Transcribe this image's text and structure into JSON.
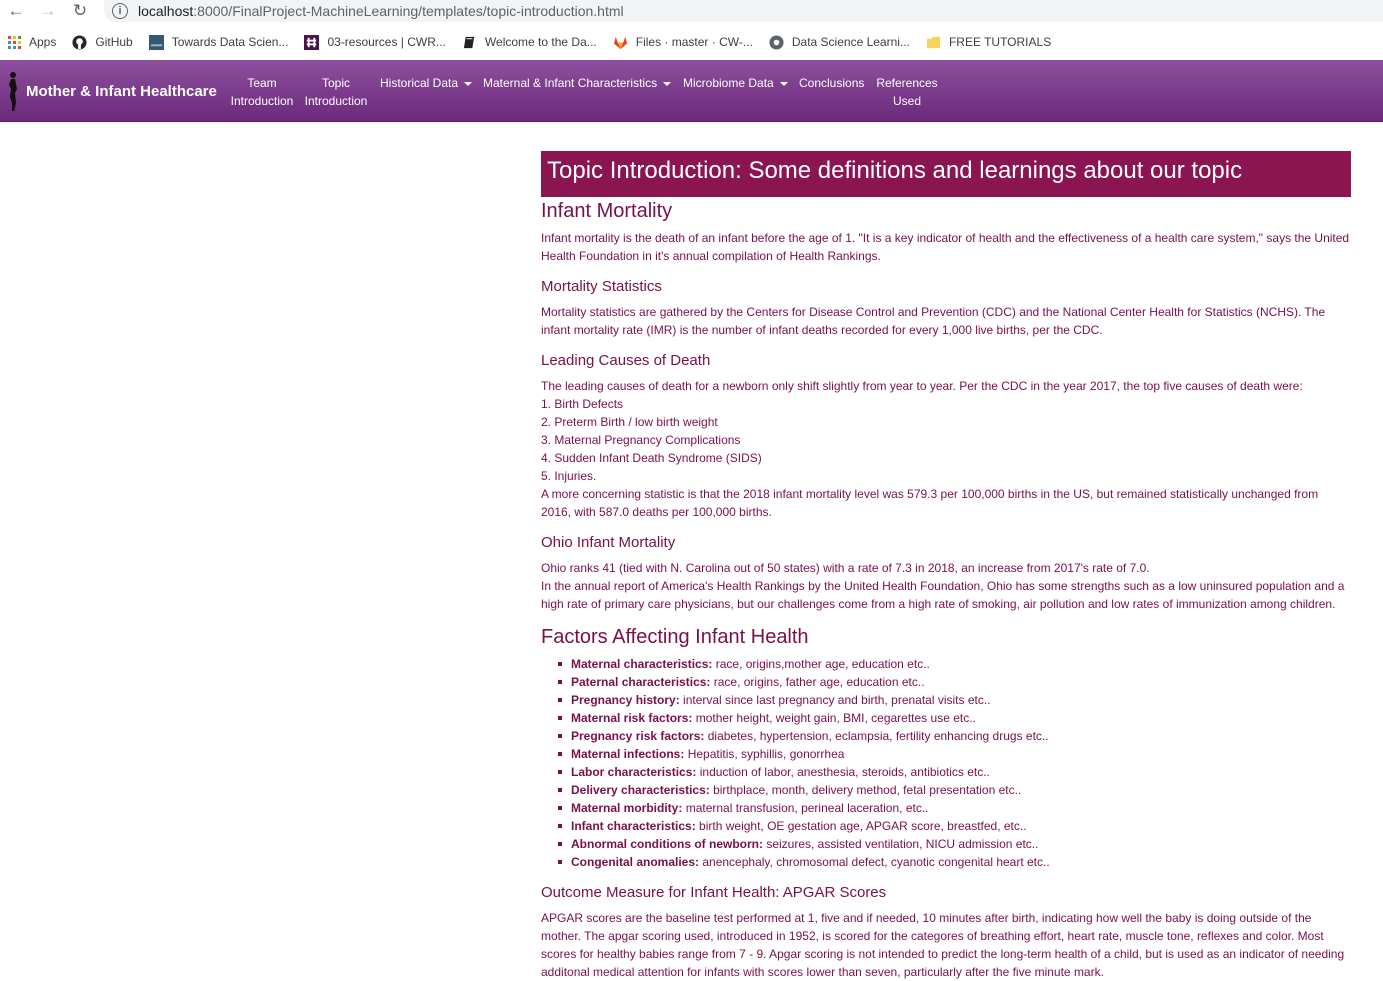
{
  "browser": {
    "url_host": "localhost",
    "url_path": ":8000/FinalProject-MachineLearning/templates/topic-introduction.html"
  },
  "bookmarks": [
    {
      "label": "Apps",
      "icon": "apps-grid-icon"
    },
    {
      "label": "GitHub",
      "icon": "github-icon"
    },
    {
      "label": "Towards Data Scien...",
      "icon": "tds-icon"
    },
    {
      "label": "03-resources | CWR...",
      "icon": "slack-icon"
    },
    {
      "label": "Welcome to the Da...",
      "icon": "book-icon"
    },
    {
      "label": "Files · master · CW-...",
      "icon": "gitlab-icon"
    },
    {
      "label": "Data Science Learni...",
      "icon": "circle-logo-icon"
    },
    {
      "label": "FREE TUTORIALS",
      "icon": "folder-icon"
    }
  ],
  "navbar": {
    "brand": "Mother & Infant Healthcare",
    "items": [
      {
        "line1": "Team",
        "line2": "Introduction"
      },
      {
        "line1": "Topic",
        "line2": "Introduction"
      },
      {
        "line1": "Historical Data",
        "line2": ""
      },
      {
        "line1": "Maternal & Infant Characteristics",
        "line2": ""
      },
      {
        "line1": "Microbiome Data",
        "line2": ""
      },
      {
        "line1": "Conclusions",
        "line2": ""
      },
      {
        "line1": "References",
        "line2": "Used"
      }
    ]
  },
  "content": {
    "title": "Topic Introduction: Some definitions and learnings about our topic",
    "infant_mortality": {
      "heading": "Infant Mortality",
      "text": "Infant mortality is the death of an infant before the age of 1. \"It is a key indicator of health and the effectiveness of a health care system,\" says the United Health Foundation in it's annual compilation of Health Rankings."
    },
    "mortality_statistics": {
      "heading": "Mortality Statistics",
      "text": "Mortality statistics are gathered by the Centers for Disease Control and Prevention (CDC) and the National Center Health for Statistics (NCHS). The infant mortality rate (IMR) is the number of infant deaths recorded for every 1,000 live births, per the CDC."
    },
    "leading_causes": {
      "heading": "Leading Causes of Death",
      "intro": "The leading causes of death for a newborn only shift slightly from year to year. Per the CDC in the year 2017, the top five causes of death were:",
      "items": [
        "1. Birth Defects",
        "2. Preterm Birth / low birth weight",
        "3. Maternal Pregnancy Complications",
        "4. Sudden Infant Death Syndrome (SIDS)",
        "5. Injuries."
      ],
      "outro": "A more concerning statistic is that the 2018 infant mortality level was 579.3 per 100,000 births in the US, but remained statistically unchanged from 2016, with 587.0 deaths per 100,000 births."
    },
    "ohio": {
      "heading": "Ohio Infant Mortality",
      "line1": "Ohio ranks 41 (tied with N. Carolina out of 50 states) with a rate of 7.3 in 2018, an increase from 2017's rate of 7.0.",
      "line2": "In the annual report of America's Health Rankings by the United Health Foundation, Ohio has some strengths such as a low uninsured population and a high rate of primary care physicians, but our challenges come from a high rate of smoking, air pollution and low rates of immunization among children."
    },
    "factors": {
      "heading": "Factors Affecting Infant Health",
      "items": [
        {
          "label": "Maternal characteristics:",
          "text": " race, origins,mother age, education etc.."
        },
        {
          "label": "Paternal characteristics:",
          "text": " race, origins, father age, education etc.."
        },
        {
          "label": "Pregnancy history:",
          "text": " interval since last pregnancy and birth, prenatal visits etc.."
        },
        {
          "label": "Maternal risk factors:",
          "text": " mother height, weight gain, BMI, cegarettes use etc.."
        },
        {
          "label": "Pregnancy risk factors:",
          "text": " diabetes, hypertension, eclampsia, fertility enhancing drugs etc.."
        },
        {
          "label": "Maternal infections:",
          "text": " Hepatitis, syphillis, gonorrhea"
        },
        {
          "label": "Labor characteristics:",
          "text": " induction of labor, anesthesia, steroids, antibiotics etc.."
        },
        {
          "label": "Delivery characteristics:",
          "text": " birthplace, month, delivery method, fetal presentation etc.."
        },
        {
          "label": "Maternal morbidity:",
          "text": " maternal transfusion, perineal laceration, etc.."
        },
        {
          "label": "Infant characteristics:",
          "text": " birth weight, OE gestation age, APGAR score, breastfed, etc.."
        },
        {
          "label": "Abnormal conditions of newborn:",
          "text": " seizures, assisted ventilation, NICU admission etc.."
        },
        {
          "label": "Congenital anomalies:",
          "text": " anencephaly, chromosomal defect, cyanotic congenital heart etc.."
        }
      ]
    },
    "apgar": {
      "heading": "Outcome Measure for Infant Health: APGAR Scores",
      "text": "APGAR scores are the baseline test performed at 1, five and if needed, 10 minutes after birth, indicating how well the baby is doing outside of the mother. The apgar scoring used, introduced in 1952, is scored for the categores of breathing effort, heart rate, muscle tone, reflexes and color. Most scores for healthy babies range from 7 - 9. Apgar scoring is not intended to predict the long-term health of a child, but is used as an indicator of needing additonal medical attention for infants with scores lower than seven, particularly after the five minute mark."
    }
  },
  "colors": {
    "navbar_top": "#8e4f9e",
    "navbar_bottom": "#6b2a7c",
    "title_bg": "#8b1551",
    "text": "#7a1048"
  }
}
